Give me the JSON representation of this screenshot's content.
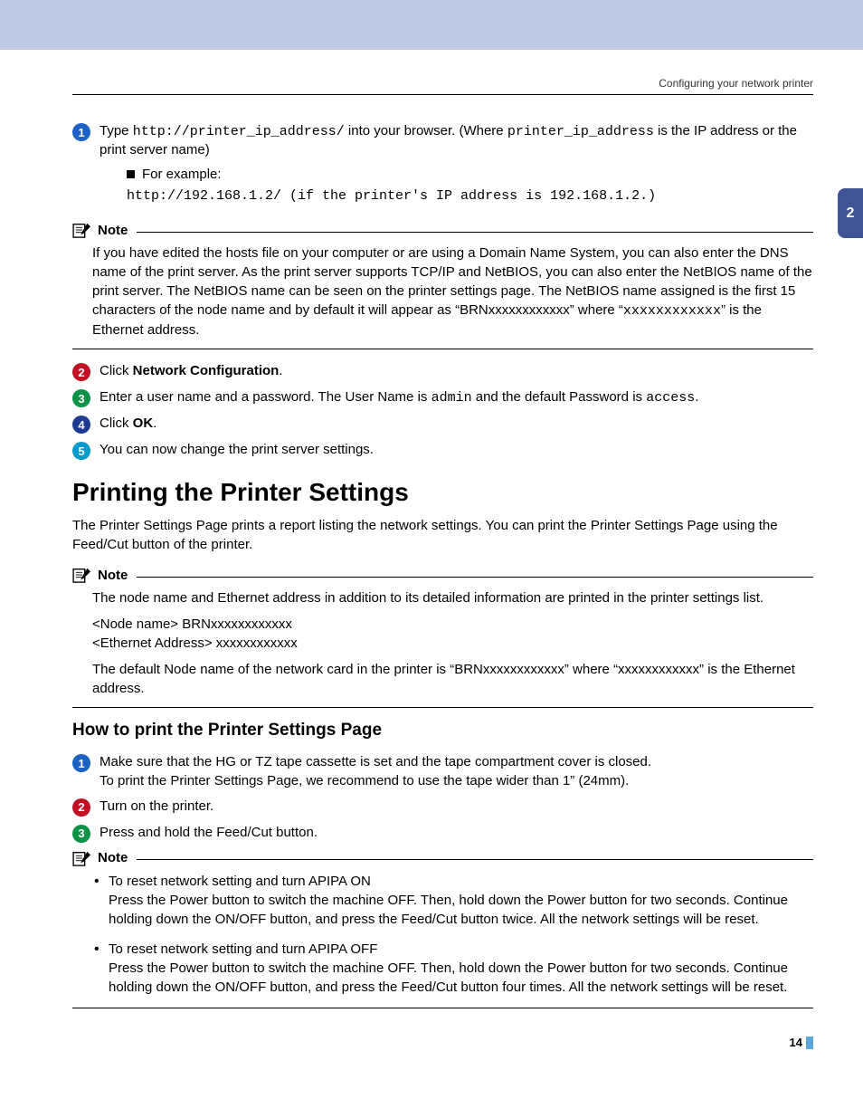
{
  "header": {
    "title": "Configuring your network printer"
  },
  "section_tab": "2",
  "steps_a": [
    {
      "num": "1",
      "color": "bg-blue",
      "text_parts": [
        "Type ",
        "http://printer_ip_address/",
        " into your browser. (Where ",
        "printer_ip_address",
        " is the IP address or the print server name)"
      ],
      "sub_label": "For example:",
      "code": "http://192.168.1.2/ (if the printer's IP address is 192.168.1.2.)"
    }
  ],
  "note1": {
    "label": "Note",
    "body_parts": [
      "If you have edited the hosts file on your computer or are using a Domain Name System, you can also enter the DNS name of the print server. As the print server supports TCP/IP and NetBIOS, you can also enter the NetBIOS name of the print server. The NetBIOS name can be seen on the printer settings page. The NetBIOS name assigned is the first 15 characters of the node name and by default it will appear as “BRNxxxxxxxxxxxx” where “",
      "xxxxxxxxxxxx",
      "” is the Ethernet address."
    ]
  },
  "steps_b": [
    {
      "num": "2",
      "color": "bg-red",
      "prefix": "Click ",
      "bold": "Network Configuration",
      "suffix": "."
    },
    {
      "num": "3",
      "color": "bg-green",
      "text_parts": [
        "Enter a user name and a password. The User Name is ",
        "admin",
        " and the default Password is ",
        "access",
        "."
      ]
    },
    {
      "num": "4",
      "color": "bg-navy",
      "prefix": "Click ",
      "bold": "OK",
      "suffix": "."
    },
    {
      "num": "5",
      "color": "bg-teal",
      "plain": "You can now change the print server settings."
    }
  ],
  "section2": {
    "title": "Printing the Printer Settings",
    "intro": "The Printer Settings Page prints a report listing the network settings. You can print the Printer Settings Page using the Feed/Cut button of the printer."
  },
  "note2": {
    "label": "Note",
    "p1": "The node name and Ethernet address in addition to its detailed information are printed in the printer settings list.",
    "p2a": "<Node name> BRNxxxxxxxxxxxx",
    "p2b": "<Ethernet Address> xxxxxxxxxxxx",
    "p3": "The default Node name of the network card in the printer is “BRNxxxxxxxxxxxx” where “xxxxxxxxxxxx” is the Ethernet address."
  },
  "subhead": "How to print the Printer Settings Page",
  "steps_c": [
    {
      "num": "1",
      "color": "bg-blue",
      "line1": "Make sure that the HG or TZ tape cassette is set and the tape compartment cover is closed.",
      "line2": "To print the Printer Settings Page, we recommend to use the tape wider than 1” (24mm)."
    },
    {
      "num": "2",
      "color": "bg-red",
      "plain": "Turn on the printer."
    },
    {
      "num": "3",
      "color": "bg-green",
      "plain": "Press and hold the Feed/Cut button."
    }
  ],
  "note3": {
    "label": "Note",
    "items": [
      {
        "head": "To reset network setting and turn APIPA ON",
        "body": "Press the Power button to switch the machine OFF. Then, hold down the Power button for two seconds. Continue holding down the ON/OFF button, and press the Feed/Cut button twice. All the network settings will be reset."
      },
      {
        "head": "To reset network setting and turn APIPA OFF",
        "body": "Press the Power button to switch the machine OFF. Then, hold down the Power button for two seconds. Continue holding down the ON/OFF button, and press the Feed/Cut button four times. All the network settings will be reset."
      }
    ]
  },
  "page_number": "14"
}
